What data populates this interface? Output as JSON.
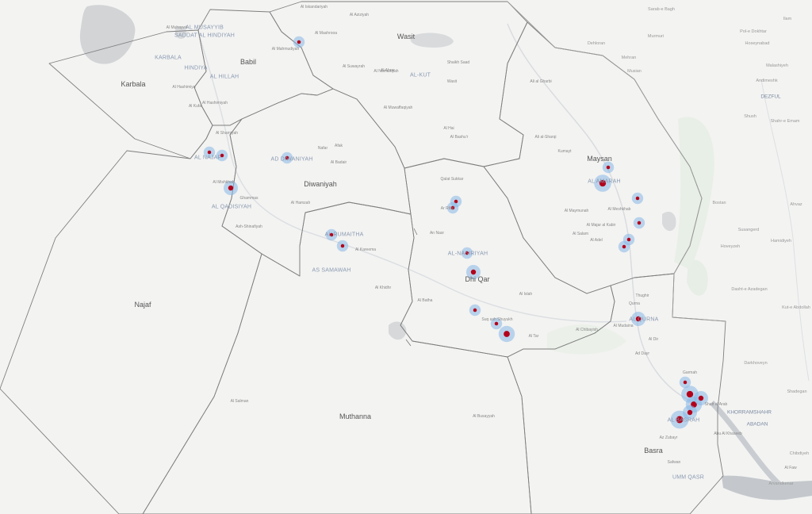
{
  "map": {
    "colors": {
      "background": "#f3f3f2",
      "water": "#d2d4d6",
      "green": "#e6eee5",
      "boundary": "#7f7f7f",
      "heat_core": "#b3001b",
      "heat_halo": "#86b6e6"
    },
    "regions": [
      {
        "label": "Karbala"
      },
      {
        "label": "Babil"
      },
      {
        "label": "Wasit"
      },
      {
        "label": "Diwaniyah"
      },
      {
        "label": "Maysan"
      },
      {
        "label": "Dhi Qar"
      },
      {
        "label": "Najaf"
      },
      {
        "label": "Muthanna"
      },
      {
        "label": "Basra"
      }
    ],
    "cities": [
      {
        "label": "AL MUSAYYIB"
      },
      {
        "label": "SADDAT AL HINDIYAH"
      },
      {
        "label": "KARBALA"
      },
      {
        "label": "HINDIYA"
      },
      {
        "label": "AL HILLAH"
      },
      {
        "label": "AL-KUT"
      },
      {
        "label": "AL NAJAF"
      },
      {
        "label": "AD DIWANIYAH"
      },
      {
        "label": "AL QADISIYAH"
      },
      {
        "label": "AL RUMAITHA"
      },
      {
        "label": "AS SAMAWAH"
      },
      {
        "label": "AL-NASIRIYAH"
      },
      {
        "label": "AL AMARAH"
      },
      {
        "label": "AL QURNA"
      },
      {
        "label": "AL BASRAH"
      },
      {
        "label": "UMM QASR"
      },
      {
        "label": "KHORRAMSHAHR"
      },
      {
        "label": "ABADAN"
      },
      {
        "label": "DEZFUL"
      }
    ],
    "towns": [
      {
        "label": "Al Iskandariyah"
      },
      {
        "label": "Al Mashrooa"
      },
      {
        "label": "Al Hashimiyah"
      },
      {
        "label": "Al Mahmudiyah"
      },
      {
        "label": "Al Suwayrah"
      },
      {
        "label": "Al Numaniyah"
      },
      {
        "label": "Al Aziziyah"
      },
      {
        "label": "Shaikh Saad"
      },
      {
        "label": "Al Hai"
      },
      {
        "label": "Al Bashu'r"
      },
      {
        "label": "Al Muwaffaqiyah"
      },
      {
        "label": "Al Ahrar"
      },
      {
        "label": "Wasit"
      },
      {
        "label": "Al Kufa"
      },
      {
        "label": "Afak"
      },
      {
        "label": "Nafar"
      },
      {
        "label": "Al Badair"
      },
      {
        "label": "Ghammas"
      },
      {
        "label": "Al Hamzah"
      },
      {
        "label": "Ash-Shinafiyah"
      },
      {
        "label": "Al Khidhr"
      },
      {
        "label": "Al Kareema"
      },
      {
        "label": "Ar Rifai"
      },
      {
        "label": "Qalat Sukkar"
      },
      {
        "label": "An Nasr"
      },
      {
        "label": "Suq ash Shuyukh"
      },
      {
        "label": "Al Islah"
      },
      {
        "label": "Al Tar"
      },
      {
        "label": "Al Batha"
      },
      {
        "label": "Al Chibayish"
      },
      {
        "label": "Ali al Gharbi"
      },
      {
        "label": "Ali al-Sharqi"
      },
      {
        "label": "Kumayt"
      },
      {
        "label": "Al Meshkhab"
      },
      {
        "label": "Al Majar al Kabir"
      },
      {
        "label": "Al Adel"
      },
      {
        "label": "Al Salam"
      },
      {
        "label": "Al Maymunah"
      },
      {
        "label": "Al Mudaina"
      },
      {
        "label": "Ad Dayr"
      },
      {
        "label": "Shatt al Arab"
      },
      {
        "label": "Abu Al Khaseeb"
      },
      {
        "label": "Safwan"
      },
      {
        "label": "Az Zubayr"
      },
      {
        "label": "Al Salman"
      },
      {
        "label": "Al Busayyah"
      },
      {
        "label": "Al Muhaywil"
      },
      {
        "label": "Al Hashimiya"
      },
      {
        "label": "Al Shamiyah"
      },
      {
        "label": "Al Mishkhab"
      },
      {
        "label": "Qurna"
      },
      {
        "label": "Al Dir"
      },
      {
        "label": "Garmah"
      },
      {
        "label": "Al Faw"
      },
      {
        "label": "Thughir"
      }
    ],
    "external": [
      {
        "label": "Sarab-e Bagh"
      },
      {
        "label": "Murmuri"
      },
      {
        "label": "Dehloran"
      },
      {
        "label": "Mehran"
      },
      {
        "label": "Musian"
      },
      {
        "label": "Shush"
      },
      {
        "label": "Shahr-e Emam"
      },
      {
        "label": "Andimeshk"
      },
      {
        "label": "Hoseynabad"
      },
      {
        "label": "Bostan"
      },
      {
        "label": "Susangerd"
      },
      {
        "label": "Hoveyzeh"
      },
      {
        "label": "Hamidiyeh"
      },
      {
        "label": "Ahvaz"
      },
      {
        "label": "Darkhoveyn"
      },
      {
        "label": "Chibdiyeh"
      },
      {
        "label": "Arvandkenar"
      },
      {
        "label": "Shadegan"
      },
      {
        "label": "Kut-e Abdollah"
      },
      {
        "label": "Dasht-e Azadegan"
      },
      {
        "label": "Malashiyeh"
      },
      {
        "label": "Pol-e Dokhtar"
      },
      {
        "label": "Ilam"
      }
    ]
  }
}
